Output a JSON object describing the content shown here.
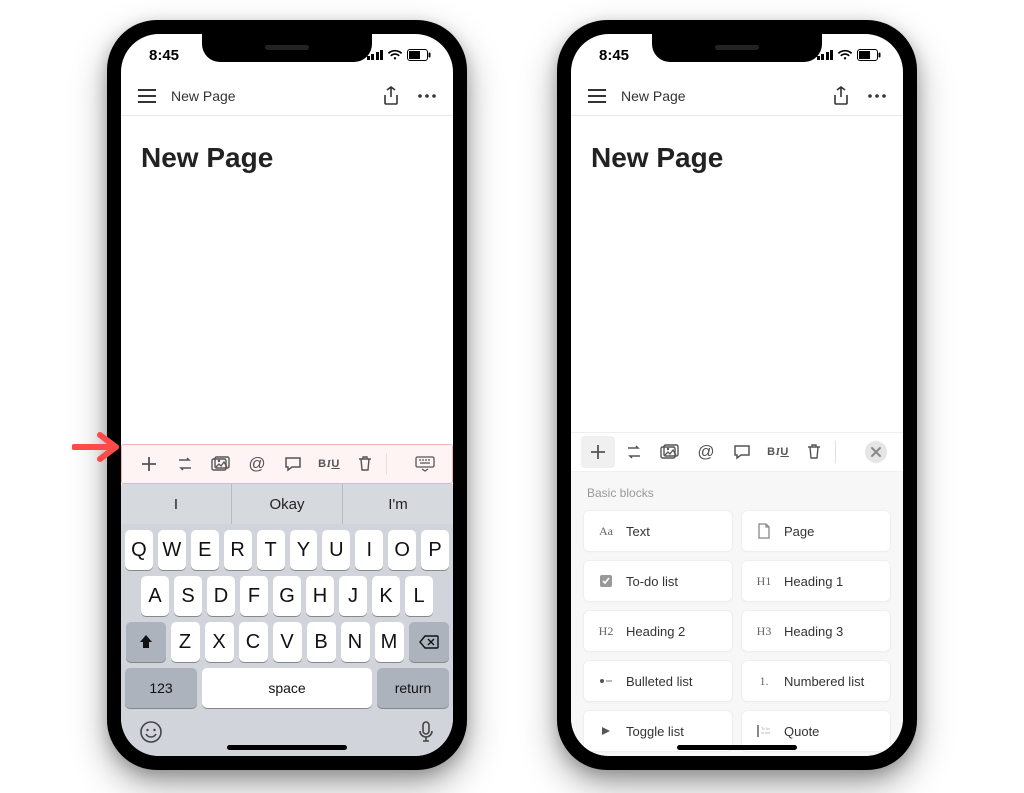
{
  "status": {
    "time": "8:45"
  },
  "nav": {
    "title": "New Page"
  },
  "page": {
    "title": "New Page"
  },
  "toolbar": {
    "biu_label": "BIU",
    "icons": {
      "plus": "plus",
      "convert": "convert",
      "image": "image",
      "mention": "@",
      "comment": "comment",
      "trash": "trash",
      "keyboard": "keyboard",
      "close": "close"
    }
  },
  "keyboard": {
    "suggestions": [
      "I",
      "Okay",
      "I'm"
    ],
    "row1": [
      "Q",
      "W",
      "E",
      "R",
      "T",
      "Y",
      "U",
      "I",
      "O",
      "P"
    ],
    "row2": [
      "A",
      "S",
      "D",
      "F",
      "G",
      "H",
      "J",
      "K",
      "L"
    ],
    "row3": [
      "Z",
      "X",
      "C",
      "V",
      "B",
      "N",
      "M"
    ],
    "num_label": "123",
    "space_label": "space",
    "return_label": "return"
  },
  "picker": {
    "section_label": "Basic blocks",
    "items": [
      {
        "icon": "Aa",
        "label": "Text"
      },
      {
        "icon": "page",
        "label": "Page"
      },
      {
        "icon": "todo",
        "label": "To-do list"
      },
      {
        "icon": "H1",
        "label": "Heading 1"
      },
      {
        "icon": "H2",
        "label": "Heading 2"
      },
      {
        "icon": "H3",
        "label": "Heading 3"
      },
      {
        "icon": "bullet",
        "label": "Bulleted list"
      },
      {
        "icon": "1.",
        "label": "Numbered list"
      },
      {
        "icon": "toggle",
        "label": "Toggle list"
      },
      {
        "icon": "quote",
        "label": "Quote"
      }
    ]
  }
}
